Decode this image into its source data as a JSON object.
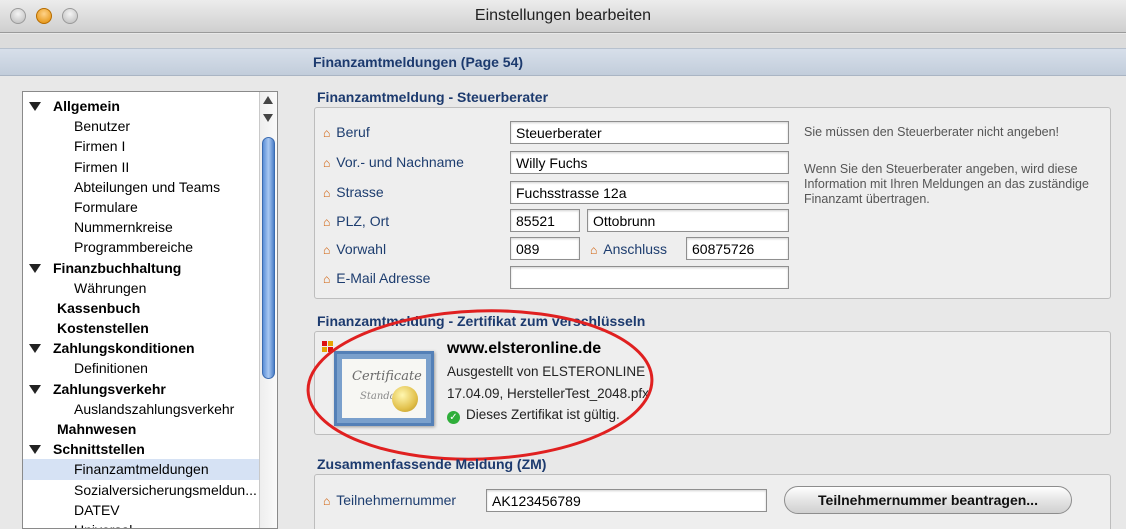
{
  "window": {
    "title": "Einstellungen bearbeiten"
  },
  "page_header": "Finanzamtmeldungen (Page 54)",
  "sidebar": {
    "items": [
      {
        "label": "Allgemein",
        "type": "section"
      },
      {
        "label": "Benutzer",
        "type": "sub"
      },
      {
        "label": "Firmen I",
        "type": "sub"
      },
      {
        "label": "Firmen II",
        "type": "sub"
      },
      {
        "label": "Abteilungen und Teams",
        "type": "sub"
      },
      {
        "label": "Formulare",
        "type": "sub"
      },
      {
        "label": "Nummernkreise",
        "type": "sub"
      },
      {
        "label": "Programmbereiche",
        "type": "sub"
      },
      {
        "label": "Finanzbuchhaltung",
        "type": "section"
      },
      {
        "label": "Währungen",
        "type": "sub"
      },
      {
        "label": "Kassenbuch",
        "type": "plain"
      },
      {
        "label": "Kostenstellen",
        "type": "plain"
      },
      {
        "label": "Zahlungskonditionen",
        "type": "section"
      },
      {
        "label": "Definitionen",
        "type": "sub"
      },
      {
        "label": "Zahlungsverkehr",
        "type": "section"
      },
      {
        "label": "Auslandszahlungsverkehr",
        "type": "sub"
      },
      {
        "label": "Mahnwesen",
        "type": "plain"
      },
      {
        "label": "Schnittstellen",
        "type": "section"
      },
      {
        "label": "Finanzamtmeldungen",
        "type": "sub",
        "selected": true
      },
      {
        "label": "Sozialversicherungsmeldun...",
        "type": "sub"
      },
      {
        "label": "DATEV",
        "type": "sub"
      },
      {
        "label": "Universal",
        "type": "sub"
      }
    ]
  },
  "steuerberater": {
    "title": "Finanzamtmeldung - Steuerberater",
    "beruf_label": "Beruf",
    "beruf_value": "Steuerberater",
    "name_label": "Vor.- und Nachname",
    "name_value": "Willy Fuchs",
    "strasse_label": "Strasse",
    "strasse_value": "Fuchsstrasse 12a",
    "plz_label": "PLZ, Ort",
    "plz_value": "85521",
    "ort_value": "Ottobrunn",
    "vorwahl_label": "Vorwahl",
    "vorwahl_value": "089",
    "anschluss_label": "Anschluss",
    "anschluss_value": "60875726",
    "email_label": "E-Mail Adresse",
    "email_value": "",
    "hint1": "Sie müssen den Steuerberater nicht angeben!",
    "hint2": "Wenn Sie den Steuerberater angeben, wird diese Information mit Ihren Meldungen an das zuständige Finanzamt übertragen."
  },
  "zertifikat": {
    "title": "Finanzamtmeldung - Zertifikat zum verschlüsseln",
    "icon_text_1": "Certificate",
    "icon_text_2": "Standard",
    "site": "www.elsteronline.de",
    "issuer": "Ausgestellt von ELSTERONLINE",
    "file": "17.04.09, HerstellerTest_2048.pfx",
    "status": "Dieses Zertifikat ist gültig.",
    "status_color": "#2fae3a",
    "annotation_color": "#e02020"
  },
  "zm": {
    "title": "Zusammenfassende Meldung (ZM)",
    "teilnehmer_label": "Teilnehmernummer",
    "teilnehmer_value": "AK123456789",
    "button_label": "Teilnehmernummer beantragen..."
  }
}
